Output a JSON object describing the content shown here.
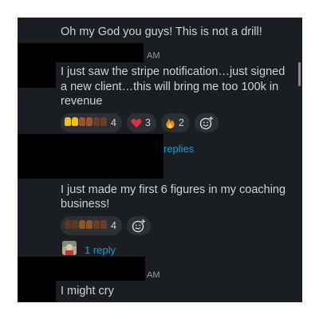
{
  "messages": {
    "m1": {
      "text": "Oh my God you guys! This is not a drill!"
    },
    "m2": {
      "time": "AM",
      "line1": "I just saw the stripe notification…just signed",
      "line2": "a new client…this will bring me too 100k in",
      "line3": "revenue",
      "reactions": [
        {
          "emoji": "raised-hands",
          "count": "4"
        },
        {
          "emoji": "heart",
          "count": "3"
        },
        {
          "emoji": "fire",
          "count": "2"
        }
      ],
      "replies": "replies"
    },
    "m3": {
      "line1": "I just made my first 6 figures in my coaching",
      "line2": "business!",
      "reactions": [
        {
          "emoji": "raised-hands",
          "count": "4"
        }
      ],
      "replies": "1 reply"
    },
    "m4": {
      "time": "AM",
      "text": "I might cry"
    }
  },
  "colors": {
    "background": "#1a1d21",
    "text": "#d1d2d3",
    "link": "#1d9bd1",
    "reaction_pill": "#2c2f34"
  }
}
